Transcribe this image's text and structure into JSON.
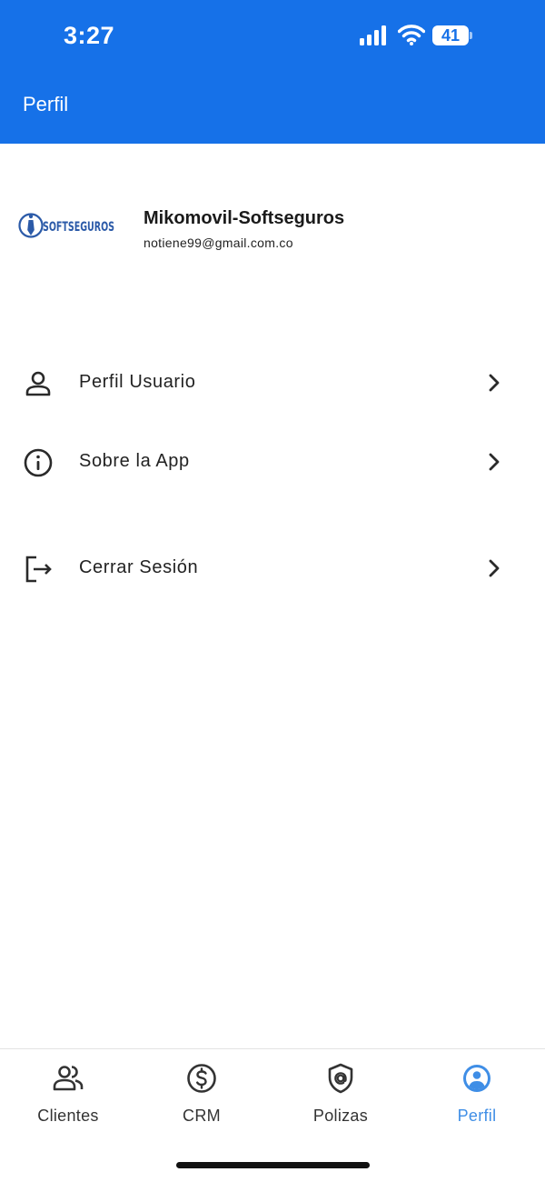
{
  "status_bar": {
    "time": "3:27",
    "battery": "41"
  },
  "header": {
    "title": "Perfil"
  },
  "profile": {
    "logo_text": "SOFTSEGUROS",
    "name": "Mikomovil-Softseguros",
    "email": "notiene99@gmail.com.co"
  },
  "menu": [
    {
      "label": "Perfil Usuario",
      "icon": "person-icon"
    },
    {
      "label": "Sobre la App",
      "icon": "info-icon"
    },
    {
      "label": "Cerrar Sesión",
      "icon": "logout-icon"
    }
  ],
  "tabs": [
    {
      "label": "Clientes",
      "icon": "users-icon",
      "active": false
    },
    {
      "label": "CRM",
      "icon": "dollar-circle-icon",
      "active": false
    },
    {
      "label": "Polizas",
      "icon": "shield-at-icon",
      "active": false
    },
    {
      "label": "Perfil",
      "icon": "profile-circle-icon",
      "active": true
    }
  ],
  "colors": {
    "header": "#1671e8",
    "active_tab": "#3f8ee6",
    "logo": "#2b5aa8"
  }
}
